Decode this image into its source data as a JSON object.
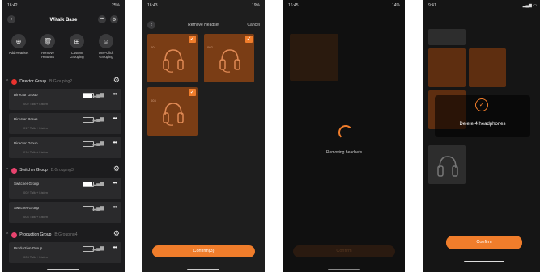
{
  "screen1": {
    "status_time": "16:42",
    "status_right": "25%",
    "title": "Witalk Base",
    "actions": [
      {
        "icon": "add-headset-icon",
        "label": "Add Headset"
      },
      {
        "icon": "remove-headset-icon",
        "label": "Remove Headset"
      },
      {
        "icon": "custom-grouping-icon",
        "label": "Custom Grouping"
      },
      {
        "icon": "one-click-grouping-icon",
        "label": "One-Click Grouping"
      }
    ],
    "groups": [
      {
        "name": "Director Group",
        "tag": "B:Grouping2",
        "color": "#e8322e",
        "members": [
          {
            "name": "Director Group",
            "sub": "002 Talk + Listen",
            "battery": 0.9
          },
          {
            "name": "Director Group",
            "sub": "017 Talk + Listen",
            "battery": 0
          },
          {
            "name": "Director Group",
            "sub": "016 Talk + Listen",
            "battery": 0
          }
        ]
      },
      {
        "name": "Switcher Group",
        "tag": "B:Grouping3",
        "color": "#e8436e",
        "members": [
          {
            "name": "Switcher Group",
            "sub": "002 Talk + Listen",
            "battery": 0.9
          },
          {
            "name": "Switcher Group",
            "sub": "004 Talk + Listen",
            "battery": 0
          }
        ]
      },
      {
        "name": "Production Group",
        "tag": "B:Grouping4",
        "color": "#e8436e",
        "members": [
          {
            "name": "Production Group",
            "sub": "003 Talk + Listen",
            "battery": 0
          }
        ]
      }
    ]
  },
  "screen2": {
    "status_time": "16:43",
    "status_right": "19%",
    "title": "Remove Headset",
    "cancel": "Cancel",
    "tiles": [
      "001",
      "002",
      "003"
    ],
    "confirm": "Confirm(3)"
  },
  "screen3": {
    "status_time": "16:45",
    "status_right": "14%",
    "loading_text": "Removing headsets",
    "confirm": "Confirm"
  },
  "screen4": {
    "status_time": "9:41",
    "toast": "Delete 4 headphones",
    "confirm": "Confirm"
  },
  "colors": {
    "accent": "#f07d2b",
    "tile_bg": "#7a3d15"
  }
}
